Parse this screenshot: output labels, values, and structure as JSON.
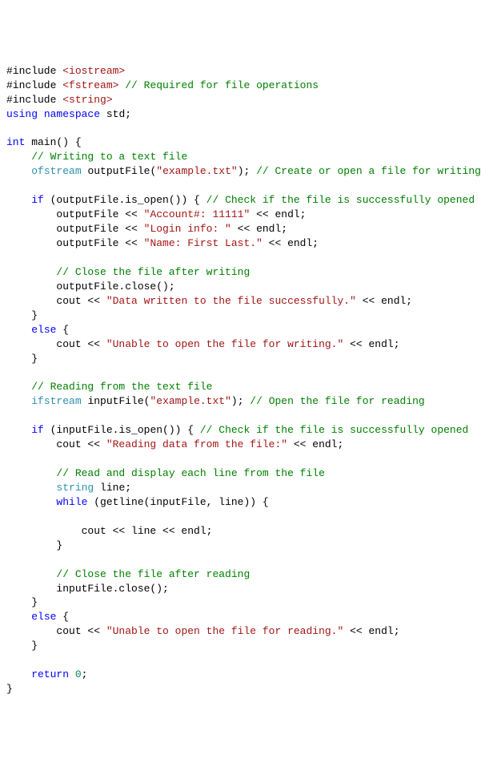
{
  "tokens": [
    {
      "cls": "id",
      "t": "#include "
    },
    {
      "cls": "pp",
      "t": "<iostream>"
    },
    {
      "cls": "nl",
      "t": "\n"
    },
    {
      "cls": "id",
      "t": "#include "
    },
    {
      "cls": "pp",
      "t": "<fstream>"
    },
    {
      "cls": "id",
      "t": " "
    },
    {
      "cls": "cm",
      "t": "// Required for file operations"
    },
    {
      "cls": "nl",
      "t": "\n"
    },
    {
      "cls": "id",
      "t": "#include "
    },
    {
      "cls": "pp",
      "t": "<string>"
    },
    {
      "cls": "nl",
      "t": "\n"
    },
    {
      "cls": "kw",
      "t": "using"
    },
    {
      "cls": "id",
      "t": " "
    },
    {
      "cls": "kw",
      "t": "namespace"
    },
    {
      "cls": "id",
      "t": " std;"
    },
    {
      "cls": "nl",
      "t": "\n"
    },
    {
      "cls": "nl",
      "t": "\n"
    },
    {
      "cls": "kw",
      "t": "int"
    },
    {
      "cls": "id",
      "t": " main() {"
    },
    {
      "cls": "nl",
      "t": "\n"
    },
    {
      "cls": "id",
      "t": "    "
    },
    {
      "cls": "cm",
      "t": "// Writing to a text file"
    },
    {
      "cls": "nl",
      "t": "\n"
    },
    {
      "cls": "id",
      "t": "    "
    },
    {
      "cls": "tp",
      "t": "ofstream"
    },
    {
      "cls": "id",
      "t": " outputFile("
    },
    {
      "cls": "st",
      "t": "\"example.txt\""
    },
    {
      "cls": "id",
      "t": "); "
    },
    {
      "cls": "cm",
      "t": "// Create or open a file for writing"
    },
    {
      "cls": "nl",
      "t": "\n"
    },
    {
      "cls": "nl",
      "t": "\n"
    },
    {
      "cls": "id",
      "t": "    "
    },
    {
      "cls": "kw",
      "t": "if"
    },
    {
      "cls": "id",
      "t": " (outputFile.is_open()) { "
    },
    {
      "cls": "cm",
      "t": "// Check if the file is successfully opened"
    },
    {
      "cls": "nl",
      "t": "\n"
    },
    {
      "cls": "id",
      "t": "        outputFile << "
    },
    {
      "cls": "st",
      "t": "\"Account#: 11111\""
    },
    {
      "cls": "id",
      "t": " << endl;"
    },
    {
      "cls": "nl",
      "t": "\n"
    },
    {
      "cls": "id",
      "t": "        outputFile << "
    },
    {
      "cls": "st",
      "t": "\"Login info: \""
    },
    {
      "cls": "id",
      "t": " << endl;"
    },
    {
      "cls": "nl",
      "t": "\n"
    },
    {
      "cls": "id",
      "t": "        outputFile << "
    },
    {
      "cls": "st",
      "t": "\"Name: First Last.\""
    },
    {
      "cls": "id",
      "t": " << endl;"
    },
    {
      "cls": "nl",
      "t": "\n"
    },
    {
      "cls": "nl",
      "t": "\n"
    },
    {
      "cls": "id",
      "t": "        "
    },
    {
      "cls": "cm",
      "t": "// Close the file after writing"
    },
    {
      "cls": "nl",
      "t": "\n"
    },
    {
      "cls": "id",
      "t": "        outputFile.close();"
    },
    {
      "cls": "nl",
      "t": "\n"
    },
    {
      "cls": "id",
      "t": "        cout << "
    },
    {
      "cls": "st",
      "t": "\"Data written to the file successfully.\""
    },
    {
      "cls": "id",
      "t": " << endl;"
    },
    {
      "cls": "nl",
      "t": "\n"
    },
    {
      "cls": "id",
      "t": "    }"
    },
    {
      "cls": "nl",
      "t": "\n"
    },
    {
      "cls": "id",
      "t": "    "
    },
    {
      "cls": "kw",
      "t": "else"
    },
    {
      "cls": "id",
      "t": " {"
    },
    {
      "cls": "nl",
      "t": "\n"
    },
    {
      "cls": "id",
      "t": "        cout << "
    },
    {
      "cls": "st",
      "t": "\"Unable to open the file for writing.\""
    },
    {
      "cls": "id",
      "t": " << endl;"
    },
    {
      "cls": "nl",
      "t": "\n"
    },
    {
      "cls": "id",
      "t": "    }"
    },
    {
      "cls": "nl",
      "t": "\n"
    },
    {
      "cls": "nl",
      "t": "\n"
    },
    {
      "cls": "id",
      "t": "    "
    },
    {
      "cls": "cm",
      "t": "// Reading from the text file"
    },
    {
      "cls": "nl",
      "t": "\n"
    },
    {
      "cls": "id",
      "t": "    "
    },
    {
      "cls": "tp",
      "t": "ifstream"
    },
    {
      "cls": "id",
      "t": " inputFile("
    },
    {
      "cls": "st",
      "t": "\"example.txt\""
    },
    {
      "cls": "id",
      "t": "); "
    },
    {
      "cls": "cm",
      "t": "// Open the file for reading"
    },
    {
      "cls": "nl",
      "t": "\n"
    },
    {
      "cls": "nl",
      "t": "\n"
    },
    {
      "cls": "id",
      "t": "    "
    },
    {
      "cls": "kw",
      "t": "if"
    },
    {
      "cls": "id",
      "t": " (inputFile.is_open()) { "
    },
    {
      "cls": "cm",
      "t": "// Check if the file is successfully opened"
    },
    {
      "cls": "nl",
      "t": "\n"
    },
    {
      "cls": "id",
      "t": "        cout << "
    },
    {
      "cls": "st",
      "t": "\"Reading data from the file:\""
    },
    {
      "cls": "id",
      "t": " << endl;"
    },
    {
      "cls": "nl",
      "t": "\n"
    },
    {
      "cls": "nl",
      "t": "\n"
    },
    {
      "cls": "id",
      "t": "        "
    },
    {
      "cls": "cm",
      "t": "// Read and display each line from the file"
    },
    {
      "cls": "nl",
      "t": "\n"
    },
    {
      "cls": "id",
      "t": "        "
    },
    {
      "cls": "tp",
      "t": "string"
    },
    {
      "cls": "id",
      "t": " line;"
    },
    {
      "cls": "nl",
      "t": "\n"
    },
    {
      "cls": "id",
      "t": "        "
    },
    {
      "cls": "kw",
      "t": "while"
    },
    {
      "cls": "id",
      "t": " (getline(inputFile, line)) {"
    },
    {
      "cls": "nl",
      "t": "\n"
    },
    {
      "cls": "nl",
      "t": "\n"
    },
    {
      "cls": "id",
      "t": "            cout << line << endl;"
    },
    {
      "cls": "nl",
      "t": "\n"
    },
    {
      "cls": "id",
      "t": "        }"
    },
    {
      "cls": "nl",
      "t": "\n"
    },
    {
      "cls": "nl",
      "t": "\n"
    },
    {
      "cls": "id",
      "t": "        "
    },
    {
      "cls": "cm",
      "t": "// Close the file after reading"
    },
    {
      "cls": "nl",
      "t": "\n"
    },
    {
      "cls": "id",
      "t": "        inputFile.close();"
    },
    {
      "cls": "nl",
      "t": "\n"
    },
    {
      "cls": "id",
      "t": "    }"
    },
    {
      "cls": "nl",
      "t": "\n"
    },
    {
      "cls": "id",
      "t": "    "
    },
    {
      "cls": "kw",
      "t": "else"
    },
    {
      "cls": "id",
      "t": " {"
    },
    {
      "cls": "nl",
      "t": "\n"
    },
    {
      "cls": "id",
      "t": "        cout << "
    },
    {
      "cls": "st",
      "t": "\"Unable to open the file for reading.\""
    },
    {
      "cls": "id",
      "t": " << endl;"
    },
    {
      "cls": "nl",
      "t": "\n"
    },
    {
      "cls": "id",
      "t": "    }"
    },
    {
      "cls": "nl",
      "t": "\n"
    },
    {
      "cls": "nl",
      "t": "\n"
    },
    {
      "cls": "id",
      "t": "    "
    },
    {
      "cls": "kw",
      "t": "return"
    },
    {
      "cls": "id",
      "t": " "
    },
    {
      "cls": "nm",
      "t": "0"
    },
    {
      "cls": "id",
      "t": ";"
    },
    {
      "cls": "nl",
      "t": "\n"
    },
    {
      "cls": "id",
      "t": "}"
    },
    {
      "cls": "nl",
      "t": "\n"
    }
  ],
  "wrap_width_chars": 76
}
